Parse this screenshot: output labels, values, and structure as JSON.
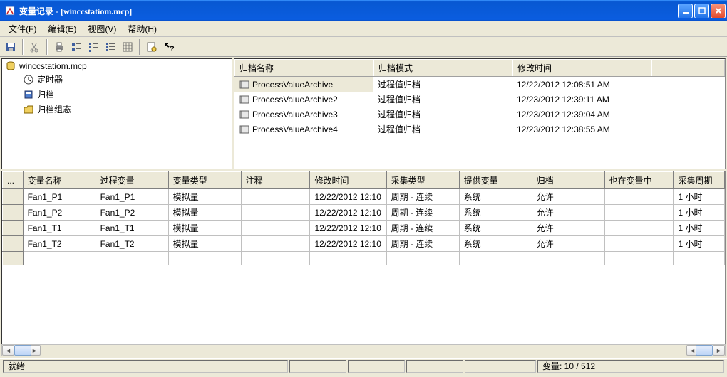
{
  "window": {
    "title": "变量记录 - [winccstatiom.mcp]"
  },
  "menu": {
    "file": "文件(F)",
    "edit": "编辑(E)",
    "view": "视图(V)",
    "help": "帮助(H)"
  },
  "tree": {
    "root": "winccstatiom.mcp",
    "nodes": [
      "定时器",
      "归档",
      "归档组态"
    ]
  },
  "listview": {
    "cols": [
      "归档名称",
      "归档模式",
      "修改时间"
    ],
    "rows": [
      {
        "name": "ProcessValueArchive",
        "mode": "过程值归档",
        "time": "12/22/2012 12:08:51 AM",
        "selected": true
      },
      {
        "name": "ProcessValueArchive2",
        "mode": "过程值归档",
        "time": "12/23/2012 12:39:11 AM",
        "selected": false
      },
      {
        "name": "ProcessValueArchive3",
        "mode": "过程值归档",
        "time": "12/23/2012 12:39:04 AM",
        "selected": false
      },
      {
        "name": "ProcessValueArchive4",
        "mode": "过程值归档",
        "time": "12/23/2012 12:38:55 AM",
        "selected": false
      }
    ]
  },
  "grid": {
    "cols": [
      "变量名称",
      "过程变量",
      "变量类型",
      "注释",
      "修改时间",
      "采集类型",
      "提供变量",
      "归档",
      "也在变量中",
      "采集周期"
    ],
    "rows": [
      {
        "c0": "Fan1_P1",
        "c1": "Fan1_P1",
        "c2": "模拟量",
        "c3": "",
        "c4": "12/22/2012 12:10",
        "c5": "周期 - 连续",
        "c6": "系统",
        "c7": "允许",
        "c8": "",
        "c9": "1 小时"
      },
      {
        "c0": "Fan1_P2",
        "c1": "Fan1_P2",
        "c2": "模拟量",
        "c3": "",
        "c4": "12/22/2012 12:10",
        "c5": "周期 - 连续",
        "c6": "系统",
        "c7": "允许",
        "c8": "",
        "c9": "1 小时"
      },
      {
        "c0": "Fan1_T1",
        "c1": "Fan1_T1",
        "c2": "模拟量",
        "c3": "",
        "c4": "12/22/2012 12:10",
        "c5": "周期 - 连续",
        "c6": "系统",
        "c7": "允许",
        "c8": "",
        "c9": "1 小时"
      },
      {
        "c0": "Fan1_T2",
        "c1": "Fan1_T2",
        "c2": "模拟量",
        "c3": "",
        "c4": "12/22/2012 12:10",
        "c5": "周期 - 连续",
        "c6": "系统",
        "c7": "允许",
        "c8": "",
        "c9": "1 小时"
      }
    ]
  },
  "status": {
    "ready": "就绪",
    "count": "变量: 10 / 512"
  }
}
